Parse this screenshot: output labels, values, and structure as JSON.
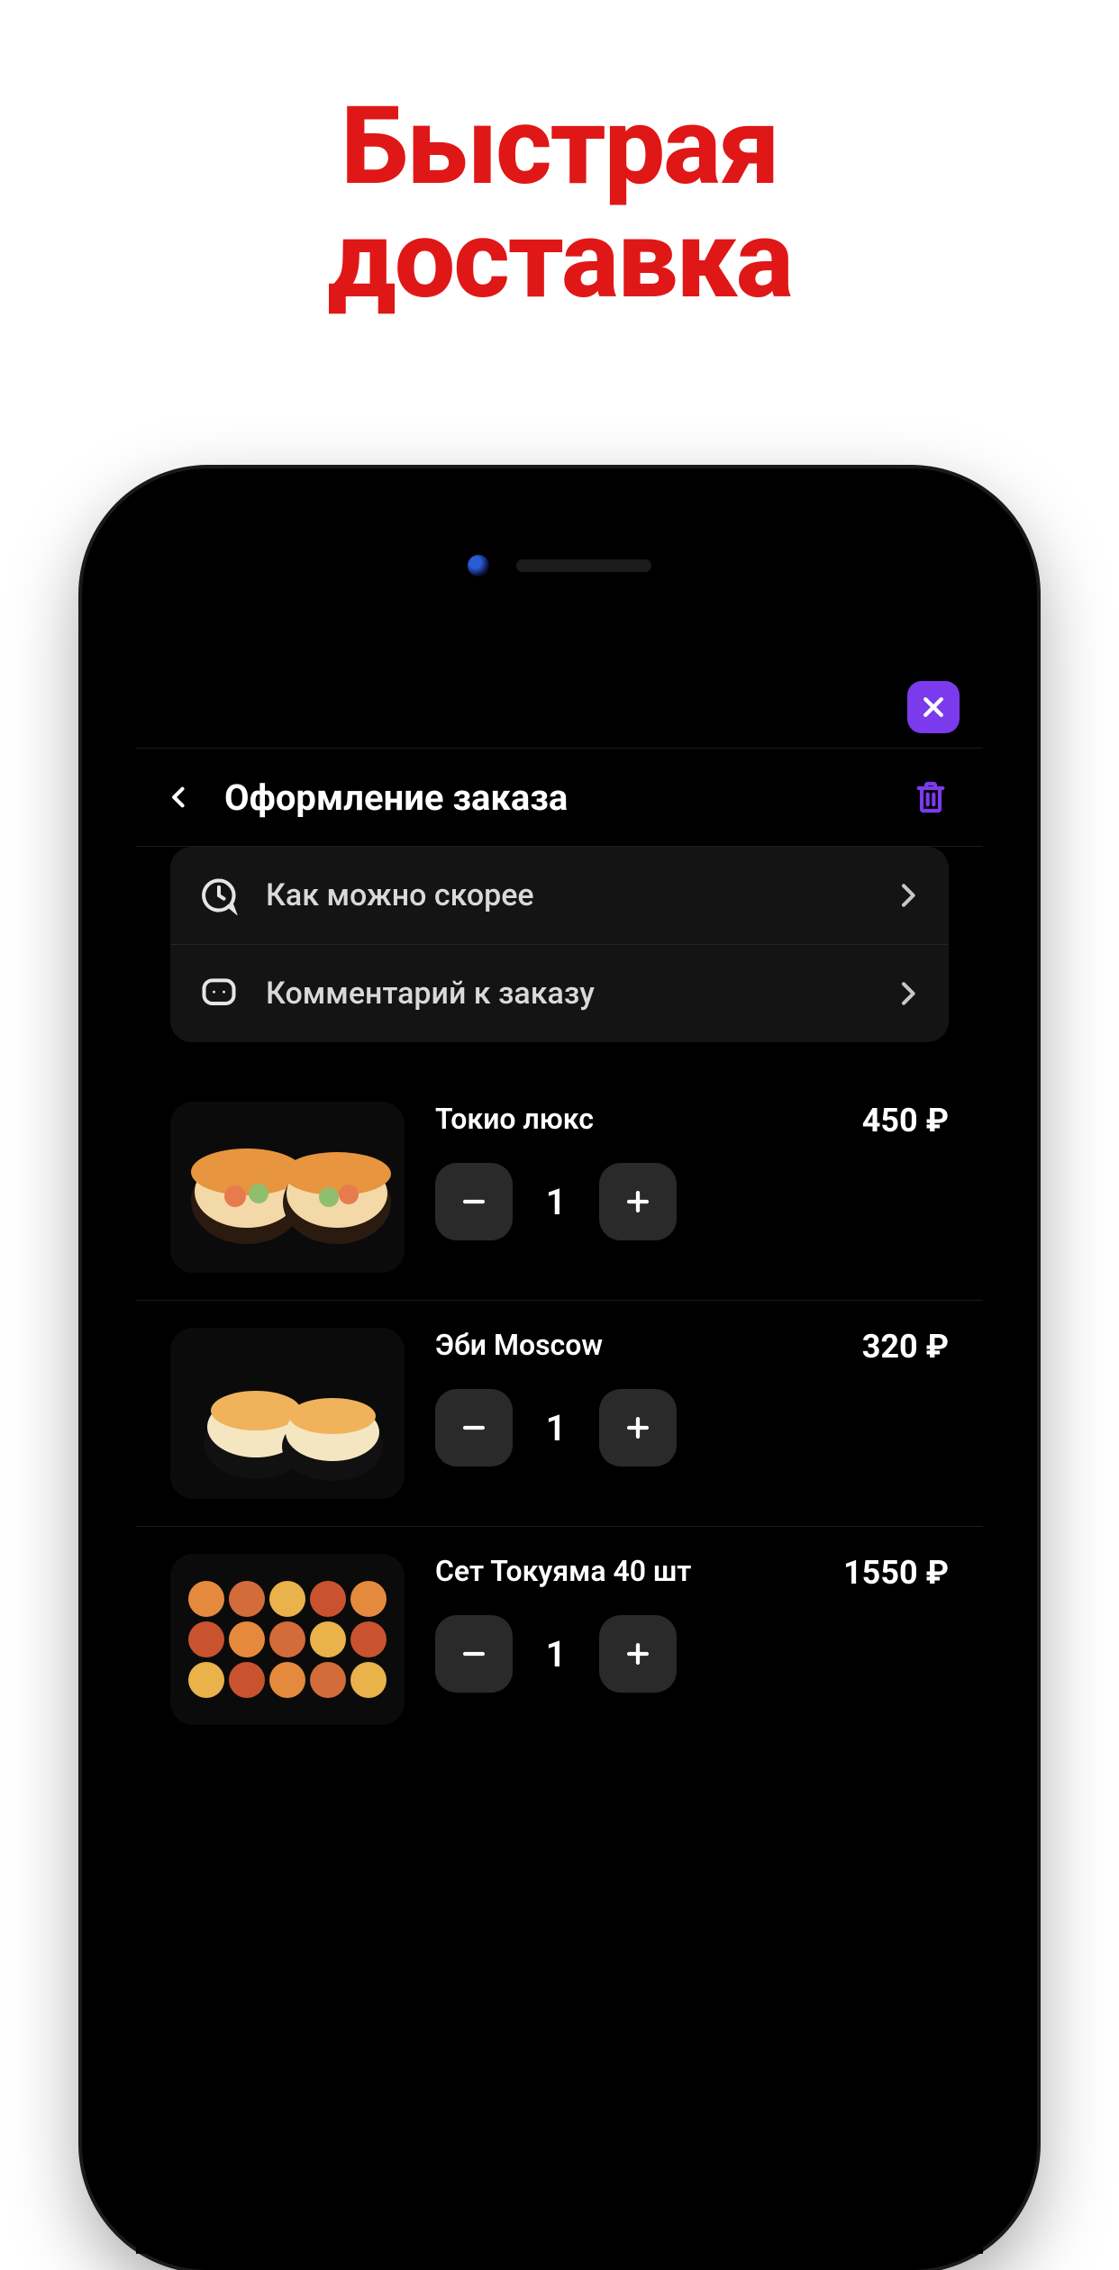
{
  "headline": {
    "line1": "Быстрая",
    "line2": "доставка"
  },
  "header": {
    "title": "Оформление заказа"
  },
  "options": [
    {
      "icon": "clock-chat-icon",
      "label": "Как можно скорее"
    },
    {
      "icon": "comment-icon",
      "label": "Комментарий к заказу"
    }
  ],
  "cart": [
    {
      "name": "Токио люкс",
      "price": "450 ₽",
      "qty": "1",
      "thumb": "sushi-pair"
    },
    {
      "name": "Эби Moscow",
      "price": "320 ₽",
      "qty": "1",
      "thumb": "sushi-ebi"
    },
    {
      "name": "Сет Токуяма 40 шт",
      "price": "1550 ₽",
      "qty": "1",
      "thumb": "sushi-set"
    }
  ],
  "colors": {
    "accent": "#7c3aed",
    "headline": "#e01717"
  }
}
